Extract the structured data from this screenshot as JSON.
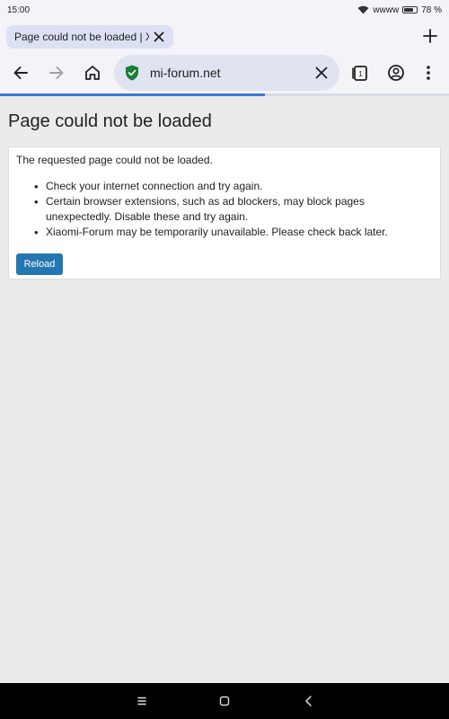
{
  "status_bar": {
    "time": "15:00",
    "carrier": "wwww",
    "battery": "78 %",
    "battery_level": 0.78
  },
  "tabs": [
    {
      "title": "Page could not be loaded | X"
    }
  ],
  "toolbar": {
    "url": "mi-forum.net",
    "tab_count": "1"
  },
  "page_load_progress": 0.59,
  "error_page": {
    "title": "Page could not be loaded",
    "lead": "The requested page could not be loaded.",
    "reasons": [
      "Check your internet connection and try again.",
      "Certain browser extensions, such as ad blockers, may block pages unexpectedly. Disable these and try again.",
      "Xiaomi-Forum may be temporarily unavailable. Please check back later."
    ],
    "reload_label": "Reload"
  },
  "colors": {
    "accent": "#3c78d8",
    "reload_button": "#2577b1",
    "shield": "#188038"
  },
  "icons": [
    "wifi-icon",
    "battery-icon",
    "close-icon",
    "plus-icon",
    "back-icon",
    "forward-icon",
    "home-icon",
    "shield-check-icon",
    "tab-switcher-icon",
    "account-icon",
    "more-menu-icon",
    "recents-icon",
    "home-nav-icon",
    "back-nav-icon"
  ]
}
